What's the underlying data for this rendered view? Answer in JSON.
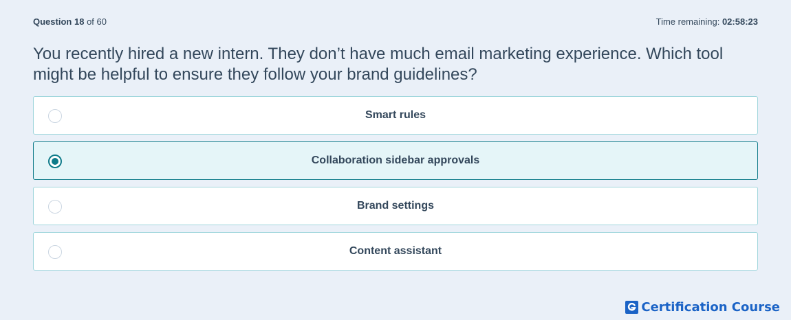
{
  "header": {
    "question_word": "Question",
    "question_number": "18",
    "question_of": "of 60",
    "timer_label": "Time remaining:",
    "timer_value": "02:58:23"
  },
  "question": {
    "text": "You recently hired a new intern. They don’t have much email marketing experience. Which tool might be helpful to ensure they follow your brand guidelines?"
  },
  "options": [
    {
      "label": "Smart rules",
      "selected": false
    },
    {
      "label": "Collaboration sidebar approvals",
      "selected": true
    },
    {
      "label": "Brand settings",
      "selected": false
    },
    {
      "label": "Content assistant",
      "selected": false
    }
  ],
  "brand": {
    "text": "Certification Course",
    "icon": "g-logo-icon"
  },
  "colors": {
    "background": "#eaf0f8",
    "text": "#33475b",
    "accent": "#0f7b8a",
    "selected_fill": "#e5f5f8",
    "brand": "#1b63c6"
  }
}
